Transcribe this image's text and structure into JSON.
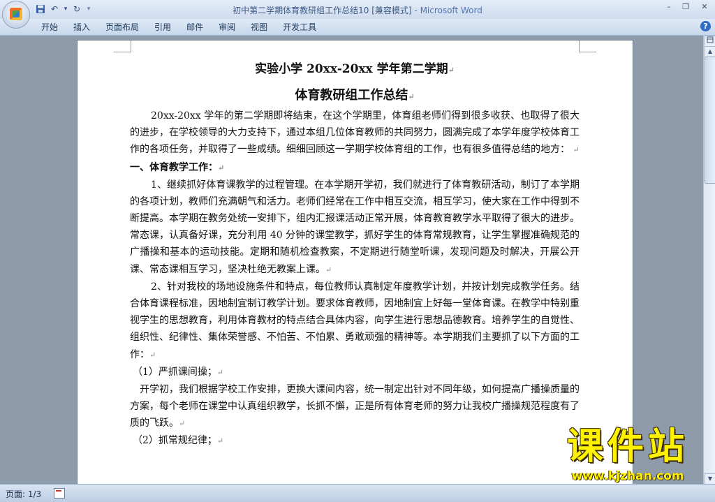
{
  "window": {
    "title": "初中第二学期体育教研组工作总结10 [兼容模式]",
    "app_name": " - Microsoft Word",
    "minimize_glyph": "–",
    "maximize_glyph": "❐",
    "close_glyph": "✕"
  },
  "quick_access": {
    "save_glyph": "▪",
    "undo_glyph": "↶",
    "undo_dropdown_glyph": "▾",
    "redo_glyph": "↻",
    "customize_glyph": "▾"
  },
  "ribbon": {
    "tabs": [
      "开始",
      "插入",
      "页面布局",
      "引用",
      "邮件",
      "审阅",
      "视图",
      "开发工具"
    ],
    "help_glyph": "?"
  },
  "document": {
    "title_line1": "实验小学 20xx-20xx 学年第二学期",
    "title_line2": "体育教研组工作总结",
    "para_mark": "↵",
    "intro": "20xx-20xx 学年的第二学期即将结束，在这个学期里，体育组老师们得到很多收获、也取得了很大的进步，在学校领导的大力支持下，通过本组几位体育教师的共同努力，圆满完成了本学年度学校体育工作的各项任务，并取得了一些成绩。细细回顾这一学期学校体育组的工作，也有很多值得总结的地方：",
    "section1_heading": "一、体育教学工作：",
    "item1": "1、继续抓好体育课教学的过程管理。在本学期开学初，我们就进行了体育教研活动，制订了本学期的各项计划，教师们充满朝气和活力。老师们经常在工作中相互交流，相互学习，使大家在工作中得到不断提高。本学期在教务处统一安排下，组内汇报课活动正常开展，体育教育教学水平取得了很大的进步。常态课，认真备好课，充分利用 40 分钟的课堂教学，抓好学生的体育常规教育，让学生掌握准确规范的广播操和基本的运动技能。定期和随机检查教案，不定期进行随堂听课，发现问题及时解决，开展公开课、常态课相互学习，坚决杜绝无教案上课。",
    "item2": "2、针对我校的场地设施条件和特点，每位教师认真制定年度教学计划，并按计划完成教学任务。结合体育课程标准，因地制宜制订教学计划。要求体育教师，因地制宜上好每一堂体育课。在教学中特别重视学生的思想教育，利用体育教材的特点结合具体内容，向学生进行思想品德教育。培养学生的自觉性、组织性、纪律性、集体荣誉感、不怕苦、不怕累、勇敢顽强的精神等。本学期我们主要抓了以下方面的工作：",
    "sub1_heading": "（1）严抓课间操；",
    "sub1_text": "开学初，我们根据学校工作安排，更换大课间内容，统一制定出针对不同年级，如何提高广播操质量的方案，每个老师在课堂中认真组织教学，长抓不懈，正是所有体育老师的努力让我校广播操规范程度有了质的飞跃。",
    "sub2_heading": "（2）抓常规纪律；"
  },
  "scrollbar": {
    "up_glyph": "▲",
    "down_glyph": "▼"
  },
  "status": {
    "page_indicator": "页面: 1/3"
  },
  "watermark": {
    "main": "课件站",
    "url": "www.kjzhan.com"
  }
}
